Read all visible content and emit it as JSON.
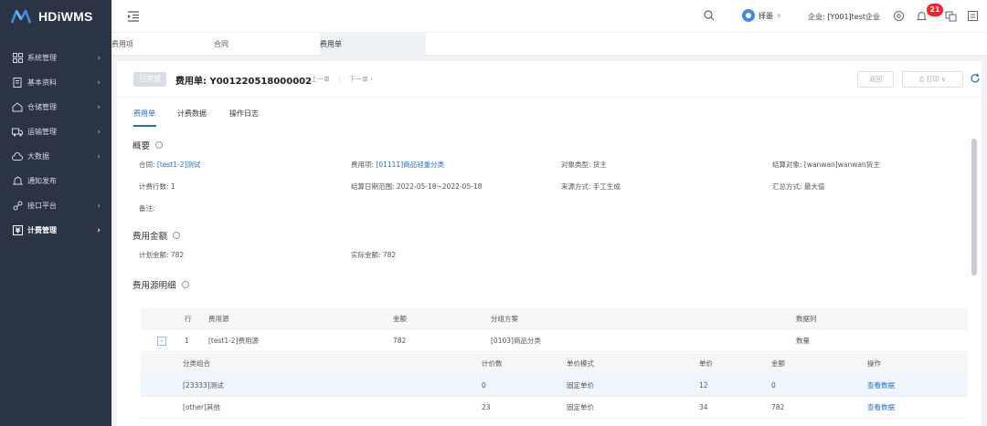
{
  "app": {
    "name": "HDiWMS"
  },
  "sidebar": {
    "items": [
      {
        "label": "系统管理",
        "icon": "grid-icon"
      },
      {
        "label": "基本资料",
        "icon": "document-icon"
      },
      {
        "label": "仓储管理",
        "icon": "warehouse-icon"
      },
      {
        "label": "运输管理",
        "icon": "truck-icon"
      },
      {
        "label": "大数据",
        "icon": "cloud-icon"
      },
      {
        "label": "通知发布",
        "icon": "bell-icon"
      },
      {
        "label": "接口平台",
        "icon": "link-icon"
      },
      {
        "label": "计费管理",
        "icon": "billing-icon",
        "active": true
      }
    ]
  },
  "header": {
    "user": "择墨",
    "company_label": "企业:",
    "company_value": "[Y001]test企业",
    "notification_count": "21"
  },
  "tabs": [
    {
      "label": "费用项"
    },
    {
      "label": "合同"
    },
    {
      "label": "费用单",
      "active": true
    }
  ],
  "doc": {
    "status": "已完成",
    "title_label": "费用单:",
    "title_value": "Y001220518000002",
    "prev": "上一单",
    "next": "下一单",
    "back_button": "返回",
    "print_button": "打印"
  },
  "subtabs": [
    {
      "label": "费用单",
      "active": true
    },
    {
      "label": "计费数据"
    },
    {
      "label": "操作日志"
    }
  ],
  "overview": {
    "title": "概要",
    "contract_label": "合同:",
    "contract_value": "[test1-2]测试",
    "fee_item_label": "费用项:",
    "fee_item_value": "[01111]商品轻重分类",
    "object_type": "对象类型: 货主",
    "settle_object": "结算对象: [wanwan]wanwan货主",
    "rows_count": "计费行数: 1",
    "settle_range": "结算日期范围: 2022-05-18~2022-05-18",
    "source_mode": "来源方式: 手工生成",
    "summary_mode": "汇总方式: 最大值",
    "remark": "备注:"
  },
  "amount": {
    "title": "费用金额",
    "planned": "计划金额: 782",
    "actual": "实际金额: 782"
  },
  "source_detail": {
    "title": "费用源明细",
    "headers": {
      "row": "行",
      "source": "费用源",
      "amount": "金额",
      "group_plan": "分组方案",
      "data_col": "数据列"
    },
    "rows": [
      {
        "expand": "-",
        "row": "1",
        "source": "[test1-2]费用源",
        "amount": "782",
        "group_plan": "[0103]商品分类",
        "data_col": "数量"
      }
    ]
  },
  "sub_detail": {
    "headers": {
      "combo": "分类组合",
      "qty": "计价数",
      "mode": "单价模式",
      "price": "单价",
      "amount": "金额",
      "op": "操作"
    },
    "rows": [
      {
        "combo": "[23333]测试",
        "qty": "0",
        "mode": "固定单价",
        "price": "12",
        "amount": "0",
        "op": "查看数据"
      },
      {
        "combo": "[other]其他",
        "qty": "23",
        "mode": "固定单价",
        "price": "34",
        "amount": "782",
        "op": "查看数据"
      }
    ]
  },
  "colors": {
    "sidebar_bg": "#2b3445",
    "accent": "#1f6fd1",
    "badge": "#f5222d"
  }
}
